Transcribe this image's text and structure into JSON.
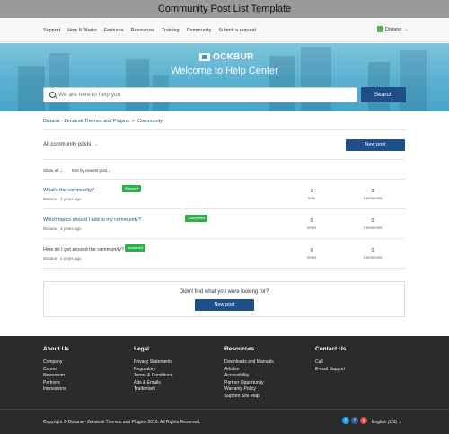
{
  "page_title": "Community Post List Template",
  "nav": {
    "links": [
      "Support",
      "How It Works",
      "Features",
      "Resources",
      "Training",
      "Community",
      "Submit a request"
    ],
    "user_name": "Diziana",
    "user_chevron": "⌄"
  },
  "hero": {
    "logo_text": "OCKBUR",
    "title": "Welcome to Help Center",
    "search_placeholder": "We are here to help you",
    "search_button": "Search"
  },
  "breadcrumb": [
    "Diziana - Zendesk Themes and Plugins",
    "Community"
  ],
  "breadcrumb_sep": ">",
  "list": {
    "filter_title": "All community posts",
    "filter_chevron": "⌄",
    "new_post_label": "New post",
    "show_all": "Show all",
    "sort_label": "Sort by newest post",
    "sort_chevron": "⌄"
  },
  "posts": [
    {
      "title": "What's the community?",
      "badge": "Planned",
      "author": "Diziana",
      "time": "3 years ago",
      "votes": "1",
      "votes_label": "Vote",
      "comments": "0",
      "comments_label": "Comments",
      "dot": "·"
    },
    {
      "title": "Which topics should I add to my community?",
      "badge": "Completed",
      "author": "Diziana",
      "time": "3 years ago",
      "votes": "0",
      "votes_label": "Votes",
      "comments": "0",
      "comments_label": "Comments",
      "dot": "·"
    },
    {
      "title": "How do I get around the community?",
      "badge": "answered",
      "author": "Diziana",
      "time": "3 years ago",
      "votes": "0",
      "votes_label": "Votes",
      "comments": "0",
      "comments_label": "Comments",
      "dot": "·"
    }
  ],
  "not_found": {
    "text": "Didn't find what you were looking for?",
    "button": "New post"
  },
  "footer": {
    "about": {
      "title": "About Us",
      "items": [
        "Company",
        "Career",
        "Newsroom",
        "Partners",
        "Innovations"
      ]
    },
    "legal": {
      "title": "Legal",
      "items": [
        "Privacy Statements",
        "Regulatory",
        "Terms & Conditions",
        "Ads & Emails",
        "Trademark"
      ]
    },
    "resources": {
      "title": "Resources",
      "items": [
        "Downloads and Manuals",
        "Articles",
        "Accessibility",
        "Partner Opportunity",
        "Warranty Policy",
        "Support Site Map"
      ]
    },
    "contact": {
      "title": "Contact Us",
      "items": [
        "Call",
        "E-mail Support"
      ]
    },
    "copyright": "Copyright © Diziana - Zendesk Themes and Plugins 2019. All Rights Reserved.",
    "language": "English (US)",
    "language_chevron": "⌄",
    "social_icons": [
      "twitter-icon",
      "facebook-icon",
      "google-plus-icon"
    ],
    "social_glyphs": [
      "t",
      "f",
      "g"
    ]
  },
  "colors": {
    "primary": "#1e4f8c",
    "badge_green": "#2db04b",
    "footer_bg": "#2b2b2b",
    "hero_blue": "#5ab0d0"
  }
}
